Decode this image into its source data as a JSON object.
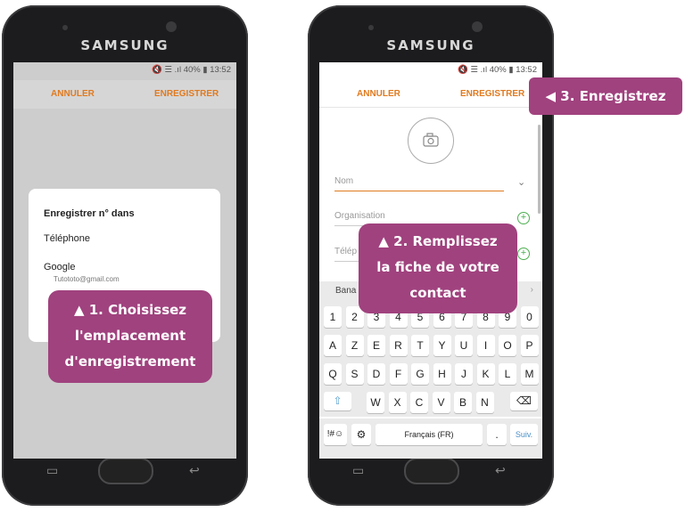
{
  "left_phone": {
    "brand": "SAMSUNG",
    "status": "🔇 ☰ .ıl 40% ▮ 13:52",
    "action_cancel": "ANNULER",
    "action_save": "ENREGISTRER",
    "dialog": {
      "title": "Enregistrer n° dans",
      "options": [
        {
          "label": "Téléphone"
        },
        {
          "label": "Google",
          "sub": "Tutototo@gmail.com"
        }
      ]
    }
  },
  "right_phone": {
    "brand": "SAMSUNG",
    "status": "🔇 ☰ .ıl 40% ▮ 13:52",
    "action_cancel": "ANNULER",
    "action_save": "ENREGISTRER",
    "fields": {
      "name": "Nom",
      "organisation": "Organisation",
      "phone": "Télép"
    },
    "suggestion_left": "Bana",
    "keyboard": {
      "row1": [
        "1",
        "2",
        "3",
        "4",
        "5",
        "6",
        "7",
        "8",
        "9",
        "0"
      ],
      "row2": [
        "A",
        "Z",
        "E",
        "R",
        "T",
        "Y",
        "U",
        "I",
        "O",
        "P"
      ],
      "row3": [
        "Q",
        "S",
        "D",
        "F",
        "G",
        "H",
        "J",
        "K",
        "L",
        "M"
      ],
      "row4": [
        "W",
        "X",
        "C",
        "V",
        "B",
        "N"
      ],
      "symbols": "!#☺",
      "space": "Français (FR)",
      "period": ".",
      "next": "Suiv."
    }
  },
  "callouts": {
    "c1_line1": "▲ 1. Choisissez",
    "c1_line2": "l'emplacement",
    "c1_line3": "d'enregistrement",
    "c2_line1": "▲ 2. Remplissez",
    "c2_line2": "la fiche de votre",
    "c2_line3": "contact",
    "c3": "◀ 3. Enregistrez"
  },
  "colors": {
    "accent_orange": "#e07a1f",
    "callout_purple": "#a0427e",
    "plus_green": "#4caf50"
  }
}
